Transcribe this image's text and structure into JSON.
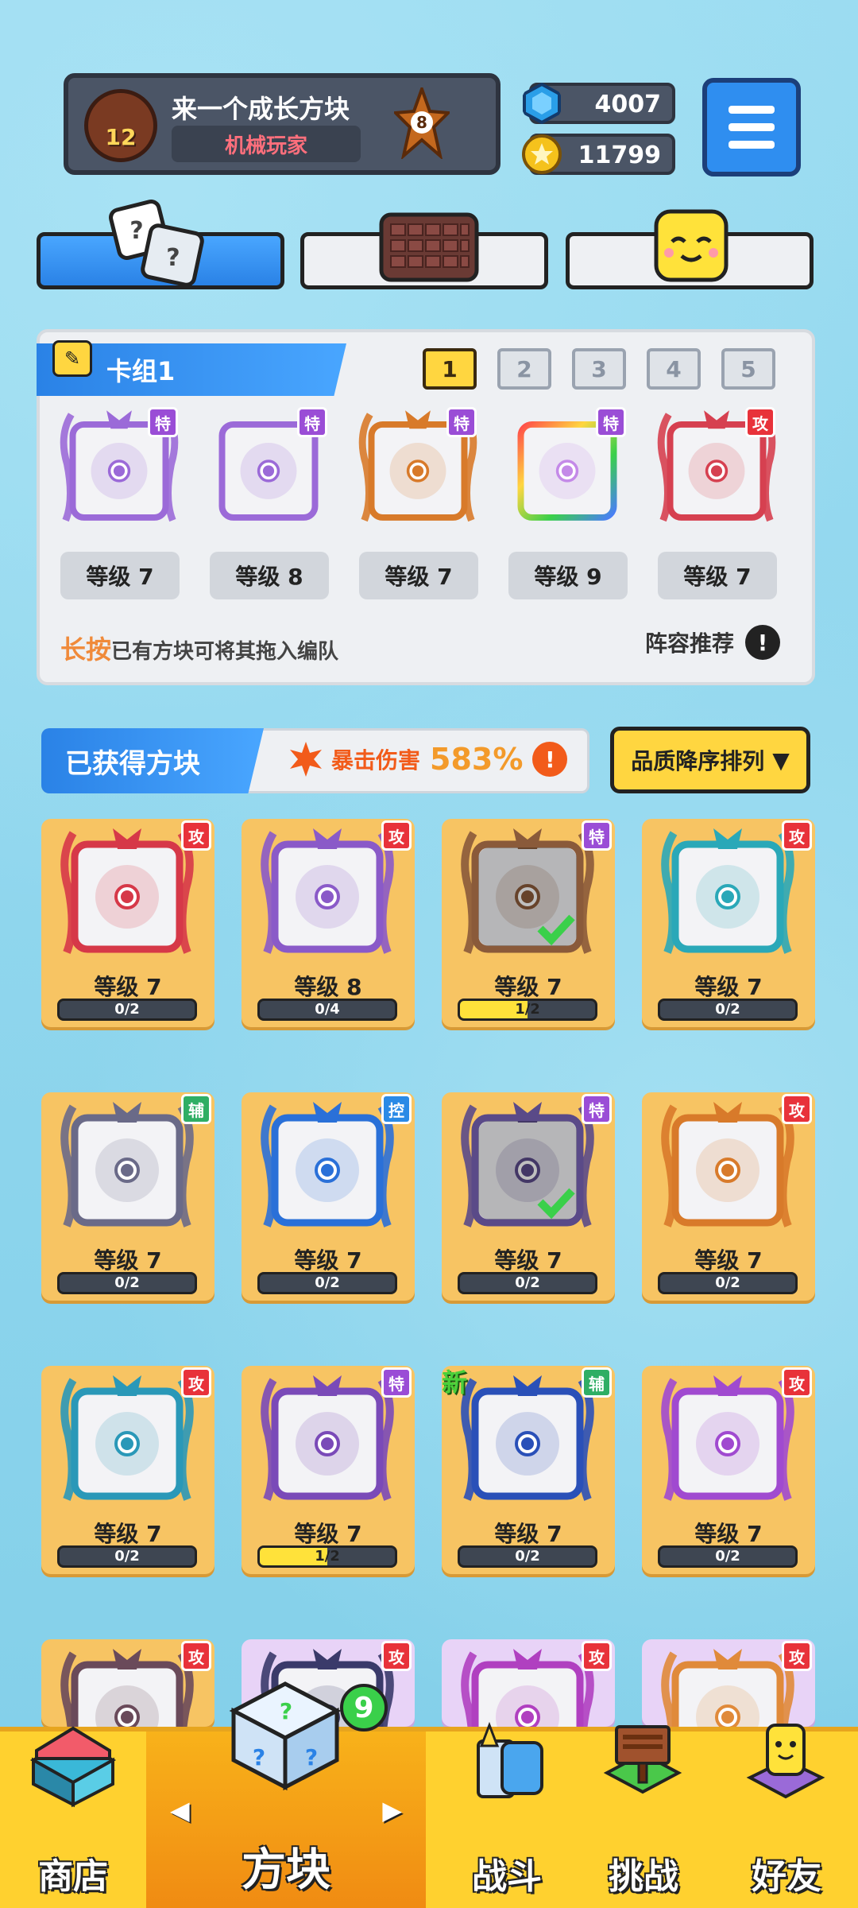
{
  "header": {
    "player_name": "来一个成长方块",
    "player_title": "机械玩家",
    "player_level": "12",
    "rank_level": "8",
    "gems": "4007",
    "coins": "11799"
  },
  "tabs": [
    "dice-tab",
    "board-tab",
    "emote-tab"
  ],
  "deck": {
    "title": "卡组1",
    "pages": [
      "1",
      "2",
      "3",
      "4",
      "5"
    ],
    "active_page": "1",
    "cards": [
      {
        "tag": "特",
        "tag_color": "purple",
        "level": "等级 7",
        "theme": "#9b6ad8",
        "frame": "purple"
      },
      {
        "tag": "特",
        "tag_color": "purple",
        "level": "等级 8",
        "theme": "#9b6ad8",
        "frame": "plain"
      },
      {
        "tag": "特",
        "tag_color": "purple",
        "level": "等级 7",
        "theme": "#d87a2a",
        "frame": "orange"
      },
      {
        "tag": "特",
        "tag_color": "purple",
        "level": "等级 9",
        "theme": "#c48ae8",
        "frame": "rainbow"
      },
      {
        "tag": "攻",
        "tag_color": "red",
        "level": "等级 7",
        "theme": "#d64050",
        "frame": "red"
      }
    ],
    "hint_bold": "长按",
    "hint_text": "已有方块可将其拖入编队",
    "recommend": "阵容推荐"
  },
  "obtained": {
    "title": "已获得方块",
    "crit_label": "暴击伤害",
    "crit_value": "583%",
    "sort_label": "品质降序排列"
  },
  "grid": [
    {
      "tag": "攻",
      "tag_color": "red",
      "level": "等级 7",
      "progress": "0/2",
      "fill": 0,
      "theme": "#d63848",
      "equipped": false,
      "new": false
    },
    {
      "tag": "攻",
      "tag_color": "red",
      "level": "等级 8",
      "progress": "0/4",
      "fill": 0,
      "theme": "#8a5ac8",
      "equipped": false,
      "new": false
    },
    {
      "tag": "特",
      "tag_color": "purple",
      "level": "等级 7",
      "progress": "1/2",
      "fill": 0.5,
      "theme": "#8a5a3a",
      "equipped": true,
      "new": false
    },
    {
      "tag": "攻",
      "tag_color": "red",
      "level": "等级 7",
      "progress": "0/2",
      "fill": 0,
      "theme": "#2aa8b8",
      "equipped": false,
      "new": false
    },
    {
      "tag": "辅",
      "tag_color": "green",
      "level": "等级 7",
      "progress": "0/2",
      "fill": 0,
      "theme": "#6a6a88",
      "equipped": false,
      "new": false
    },
    {
      "tag": "控",
      "tag_color": "blue",
      "level": "等级 7",
      "progress": "0/2",
      "fill": 0,
      "theme": "#2a70d8",
      "equipped": false,
      "new": false
    },
    {
      "tag": "特",
      "tag_color": "purple",
      "level": "等级 7",
      "progress": "0/2",
      "fill": 0,
      "theme": "#5a4a88",
      "equipped": true,
      "new": false
    },
    {
      "tag": "攻",
      "tag_color": "red",
      "level": "等级 7",
      "progress": "0/2",
      "fill": 0,
      "theme": "#d87a2a",
      "equipped": false,
      "new": false
    },
    {
      "tag": "攻",
      "tag_color": "red",
      "level": "等级 7",
      "progress": "0/2",
      "fill": 0,
      "theme": "#2a98b8",
      "equipped": false,
      "new": false
    },
    {
      "tag": "特",
      "tag_color": "purple",
      "level": "等级 7",
      "progress": "1/2",
      "fill": 0.5,
      "theme": "#7a4ab8",
      "equipped": false,
      "new": false
    },
    {
      "tag": "辅",
      "tag_color": "green",
      "level": "等级 7",
      "progress": "0/2",
      "fill": 0,
      "theme": "#2a50b8",
      "equipped": false,
      "new": true,
      "new_label": "新"
    },
    {
      "tag": "攻",
      "tag_color": "red",
      "level": "等级 7",
      "progress": "0/2",
      "fill": 0,
      "theme": "#a04ad0",
      "equipped": false,
      "new": false
    },
    {
      "tag": "攻",
      "tag_color": "red",
      "level": "",
      "progress": "",
      "fill": 0,
      "theme": "#6a4a5a",
      "equipped": false,
      "new": false
    },
    {
      "tag": "攻",
      "tag_color": "red",
      "level": "",
      "progress": "",
      "fill": 0,
      "theme": "#3a3a6a",
      "equipped": false,
      "new": false,
      "purple": true
    },
    {
      "tag": "攻",
      "tag_color": "red",
      "level": "",
      "progress": "",
      "fill": 0,
      "theme": "#b040c0",
      "equipped": false,
      "new": false,
      "purple": true
    },
    {
      "tag": "攻",
      "tag_color": "red",
      "level": "",
      "progress": "",
      "fill": 0,
      "theme": "#e08a3a",
      "equipped": false,
      "new": false,
      "purple": true
    }
  ],
  "nav": {
    "shop": "商店",
    "dice": "方块",
    "battle": "战斗",
    "challenge": "挑战",
    "friends": "好友",
    "dice_badge": "9"
  },
  "colors": {
    "accent": "#2a82e6",
    "card": "#f7c463",
    "nav": "#ffd12f"
  }
}
